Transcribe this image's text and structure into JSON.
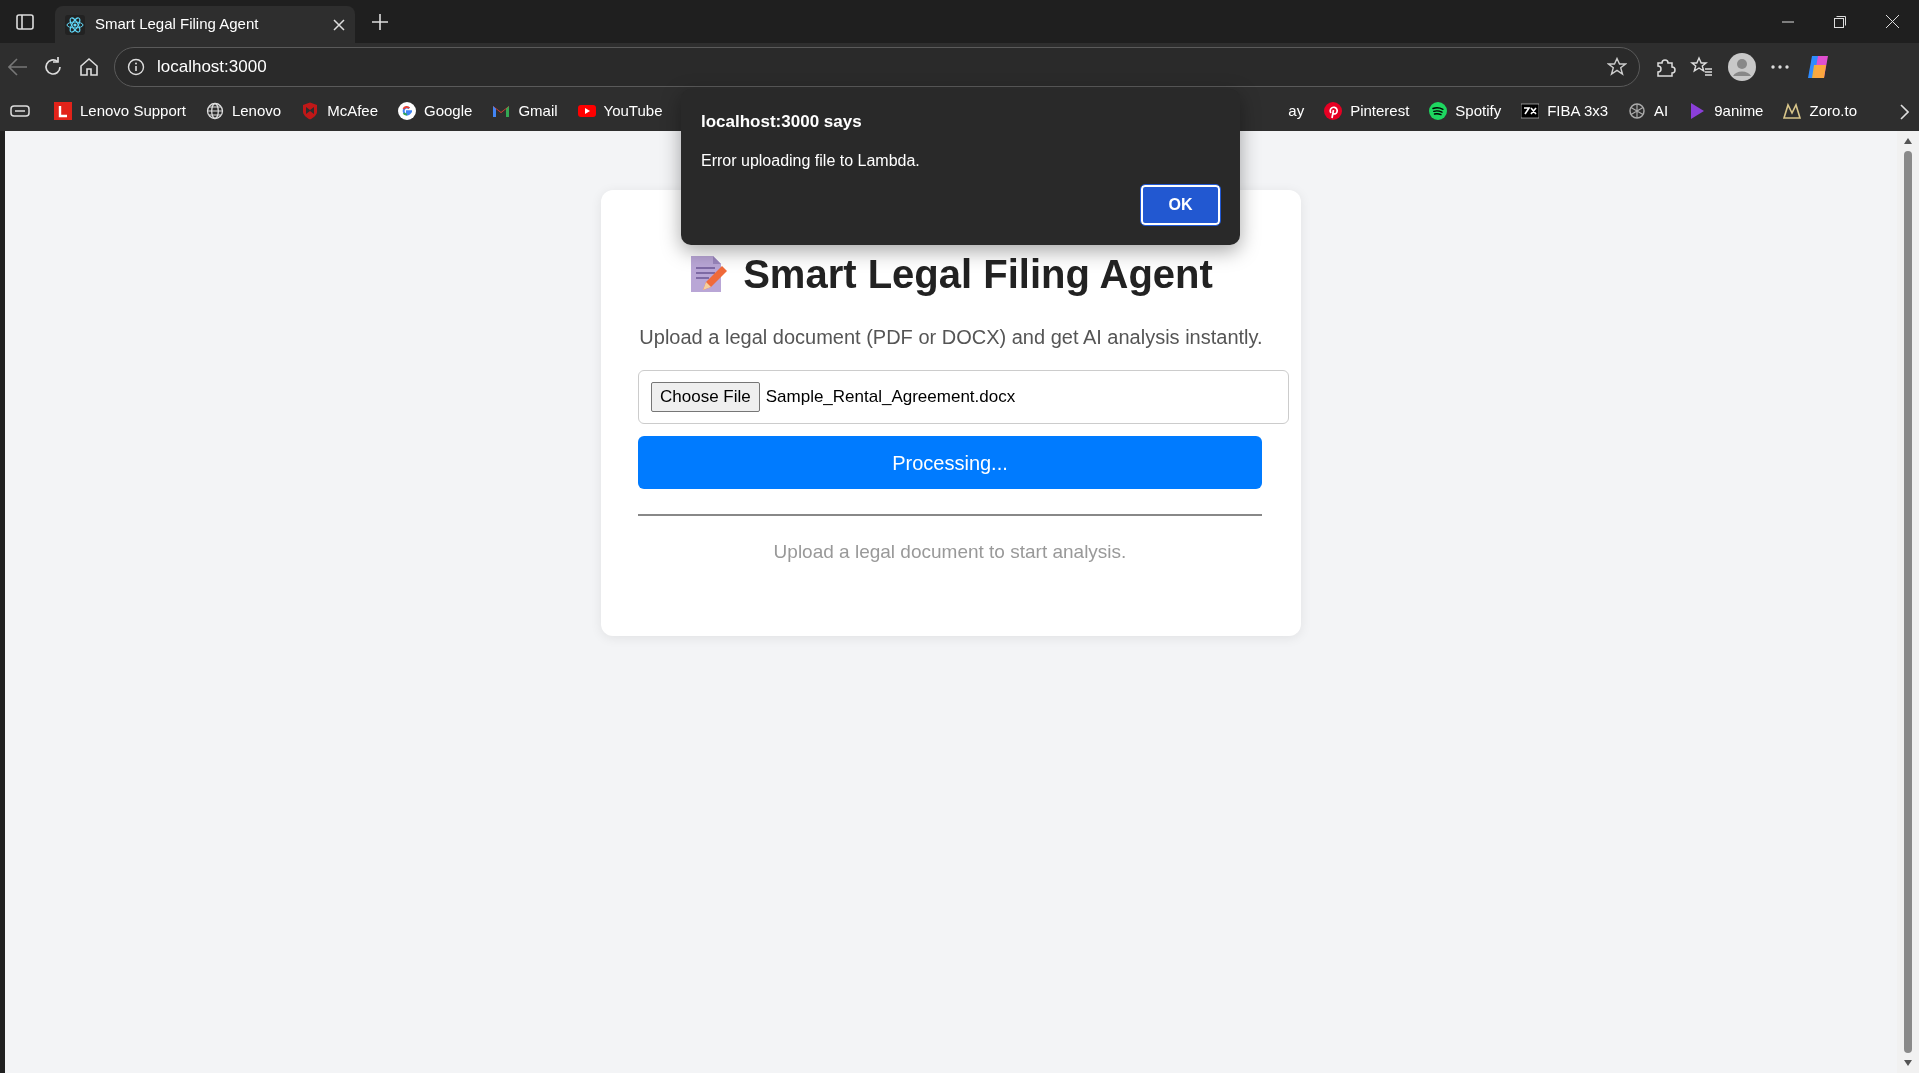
{
  "browser": {
    "tab": {
      "title": "Smart Legal Filing Agent"
    },
    "address": "localhost:3000",
    "bookmarks": [
      {
        "label": "Lenovo Support",
        "kind": "lenovo"
      },
      {
        "label": "Lenovo",
        "kind": "globe"
      },
      {
        "label": "McAfee",
        "kind": "mcafee"
      },
      {
        "label": "Google",
        "kind": "google"
      },
      {
        "label": "Gmail",
        "kind": "gmail"
      },
      {
        "label": "YouTube",
        "kind": "youtube"
      },
      {
        "label": "ay",
        "kind": "hidden"
      },
      {
        "label": "Pinterest",
        "kind": "pinterest"
      },
      {
        "label": "Spotify",
        "kind": "spotify"
      },
      {
        "label": "FIBA 3x3",
        "kind": "fiba"
      },
      {
        "label": "AI",
        "kind": "ai"
      },
      {
        "label": "9anime",
        "kind": "play"
      },
      {
        "label": "Zoro.to",
        "kind": "zoro"
      }
    ]
  },
  "page": {
    "title": "Smart Legal Filing Agent",
    "subtitle": "Upload a legal document (PDF or DOCX) and get AI analysis instantly.",
    "file_input": {
      "button": "Choose File",
      "value": "Sample_Rental_Agreement.docx"
    },
    "submit_button": "Processing...",
    "status": "Upload a legal document to start analysis."
  },
  "dialog": {
    "title": "localhost:3000 says",
    "message": "Error uploading file to Lambda.",
    "button": "OK"
  }
}
